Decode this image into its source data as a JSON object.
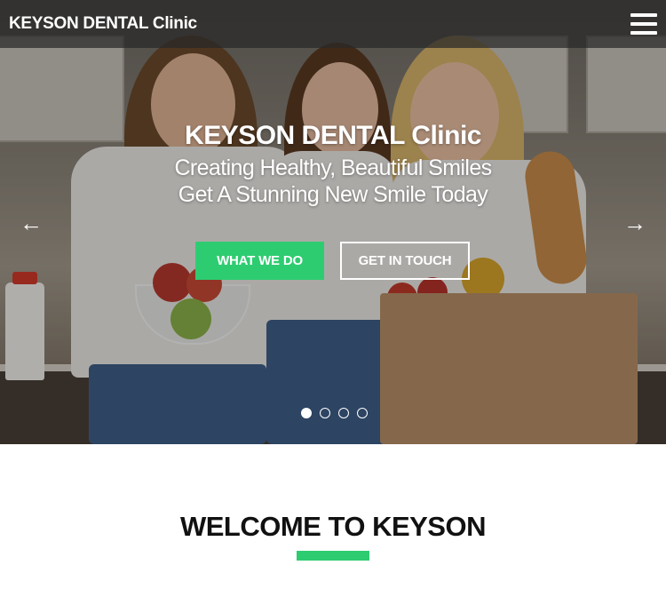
{
  "header": {
    "brand": "KEYSON DENTAL Clinic",
    "menu_icon": "hamburger-menu-icon"
  },
  "hero": {
    "title": "KEYSON DENTAL Clinic",
    "subtitle_line1": "Creating Healthy, Beautiful Smiles",
    "subtitle_line2": "Get A Stunning New Smile Today",
    "primary_button": "WHAT WE DO",
    "secondary_button": "GET IN TOUCH",
    "prev_arrow": "←",
    "next_arrow": "→",
    "slide_count": 4,
    "active_slide": 1
  },
  "welcome": {
    "heading": "WELCOME TO KEYSON"
  },
  "colors": {
    "accent": "#2ecc71",
    "header_bg": "#2e2e2e",
    "text_dark": "#111111"
  }
}
